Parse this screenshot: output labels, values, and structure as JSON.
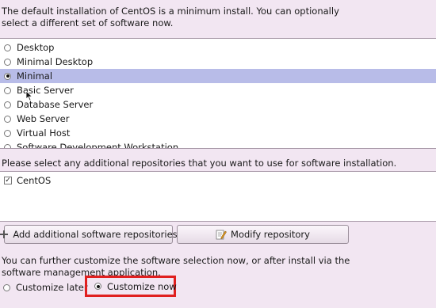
{
  "intro_text": "The default installation of CentOS is a minimum install. You can optionally select a different set of software now.",
  "software_sets": [
    {
      "label": "Desktop",
      "selected": false
    },
    {
      "label": "Minimal Desktop",
      "selected": false
    },
    {
      "label": "Minimal",
      "selected": true
    },
    {
      "label": "Basic Server",
      "selected": false
    },
    {
      "label": "Database Server",
      "selected": false
    },
    {
      "label": "Web Server",
      "selected": false
    },
    {
      "label": "Virtual Host",
      "selected": false
    },
    {
      "label": "Software Development Workstation",
      "selected": false
    }
  ],
  "repos": {
    "prompt": "Please select any additional repositories that you want to use for software installation.",
    "items": [
      {
        "label": "CentOS",
        "checked": true,
        "check_glyph": "✓"
      }
    ]
  },
  "buttons": {
    "add_repos": "Add additional software repositories",
    "modify_repo": "Modify repository"
  },
  "customize": {
    "text": "You can further customize the software selection now, or after install via the software management application.",
    "later_label": "Customize later",
    "now_label": "Customize now",
    "selected": "now"
  },
  "colors": {
    "background": "#f2e6f2",
    "selection": "#b8bce8",
    "highlight_border": "#e02020"
  },
  "icons": {
    "add": "plus-icon",
    "modify": "edit-document-icon"
  }
}
